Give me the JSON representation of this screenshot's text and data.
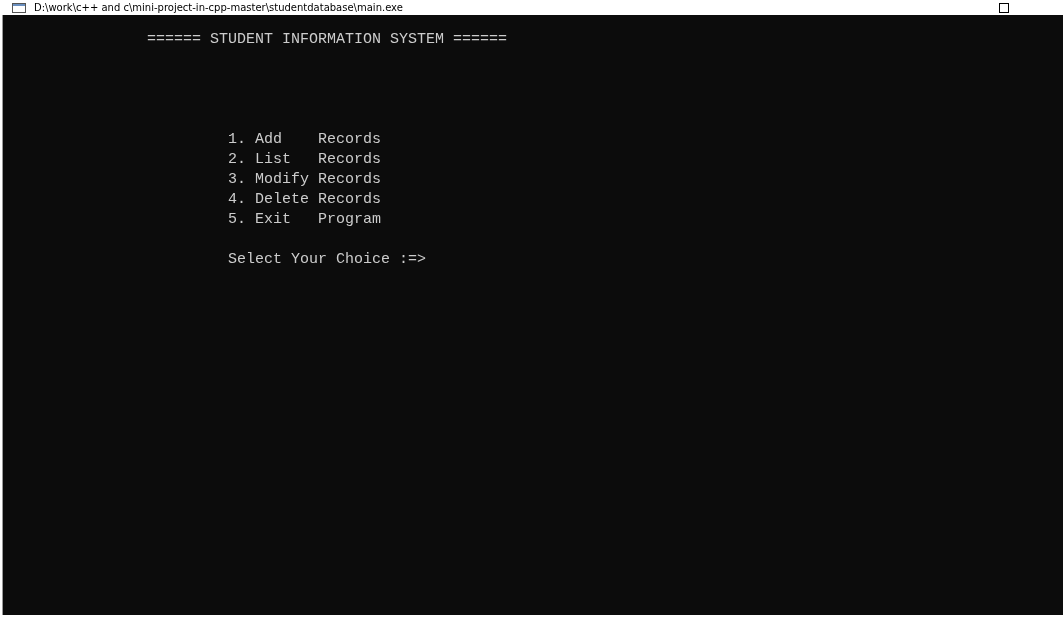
{
  "window": {
    "title": "D:\\work\\c++ and c\\mini-project-in-cpp-master\\studentdatabase\\main.exe"
  },
  "console": {
    "heading": "====== STUDENT INFORMATION SYSTEM ======",
    "menu": [
      "1. Add    Records",
      "2. List   Records",
      "3. Modify Records",
      "4. Delete Records",
      "5. Exit   Program"
    ],
    "prompt": "Select Your Choice :=>"
  }
}
